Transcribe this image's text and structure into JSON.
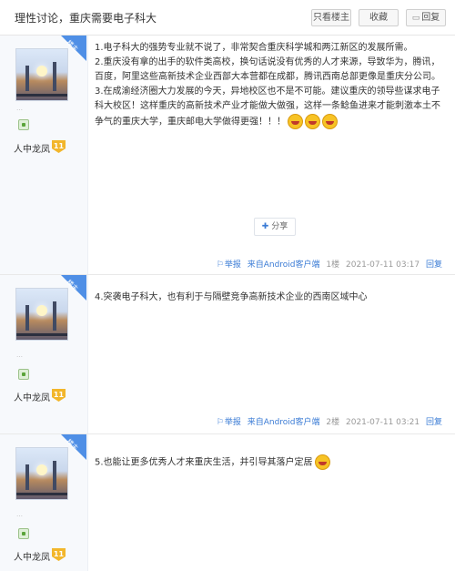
{
  "header": {
    "title": "理性讨论，重庆需要电子科大",
    "only_op_label": "只看楼主",
    "favorite_label": "收藏",
    "reply_label": "回复"
  },
  "posts": [
    {
      "author_nick": "… ",
      "level_name": "人中龙凤",
      "level": "11",
      "is_op": true,
      "op_label": "楼主",
      "lines": [
        "1.电子科大的强势专业就不说了，非常契合重庆科学城和两江新区的发展所需。",
        "2.重庆没有拿的出手的软件类高校，换句话说没有优秀的人才来源，导致华为，腾讯，百度，阿里这些高新技术企业西部大本营都在成都，腾讯西南总部更像是重庆分公司。",
        "3.在成渝经济圈大力发展的今天，异地校区也不是不可能。建议重庆的领导些谋求电子科大校区！这样重庆的高新技术产业才能做大做强，这样一条鲶鱼进来才能刺激本土不争气的重庆大学，重庆邮电大学做得更强！！！"
      ],
      "share_label": "分享",
      "report_label": "举报",
      "client_label": "来自Android客户端",
      "floor": "1楼",
      "time": "2021-07-11 03:17",
      "reply_label": "回复"
    },
    {
      "author_nick": "…",
      "level_name": "人中龙凤",
      "level": "11",
      "is_op": true,
      "op_label": "楼主",
      "lines": [
        "4.突袭电子科大，也有利于与隔壁竞争高新技术企业的西南区域中心"
      ],
      "report_label": "举报",
      "client_label": "来自Android客户端",
      "floor": "2楼",
      "time": "2021-07-11 03:21",
      "reply_label": "回复"
    },
    {
      "author_nick": "…",
      "level_name": "人中龙凤",
      "level": "11",
      "is_op": true,
      "op_label": "楼主",
      "lines": [
        "5.也能让更多优秀人才来重庆生活，并引导其落户定居"
      ]
    }
  ]
}
